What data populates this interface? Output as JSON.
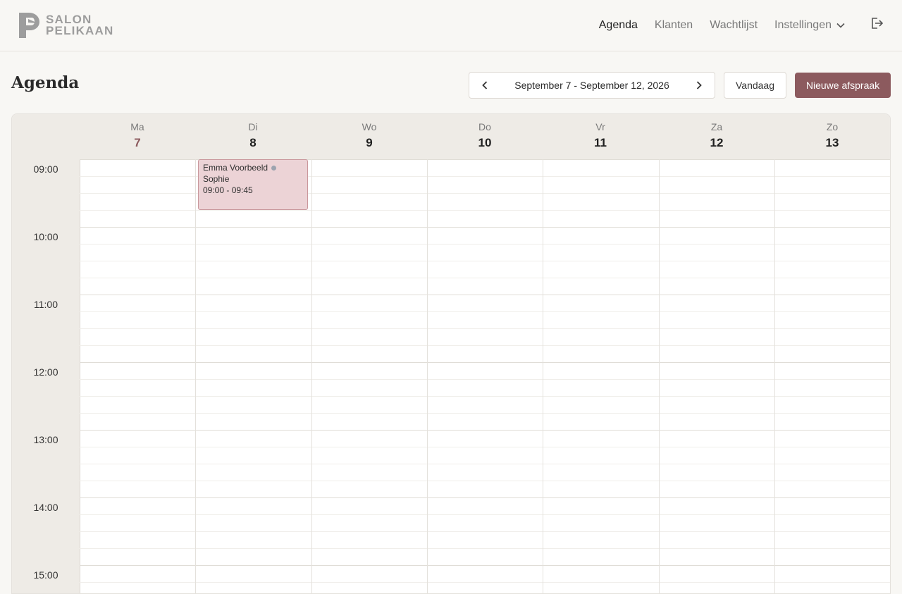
{
  "app": {
    "logo_line1": "SALON",
    "logo_line2": "PELIKAAN",
    "nav": [
      {
        "label": "Agenda",
        "active": true
      },
      {
        "label": "Klanten"
      },
      {
        "label": "Wachtlijst"
      },
      {
        "label": "Instellingen"
      }
    ]
  },
  "page": {
    "title": "Agenda",
    "date_range": "September 7 - September 12, 2026",
    "today_label": "Vandaag",
    "new_label": "Nieuwe afspraak"
  },
  "calendar": {
    "days": [
      {
        "name": "Ma",
        "date": "7",
        "today": true
      },
      {
        "name": "Di",
        "date": "8"
      },
      {
        "name": "Wo",
        "date": "9"
      },
      {
        "name": "Do",
        "date": "10"
      },
      {
        "name": "Vr",
        "date": "11"
      },
      {
        "name": "Za",
        "date": "12"
      },
      {
        "name": "Zo",
        "date": "13"
      }
    ],
    "hours": [
      "09:00",
      "10:00",
      "11:00",
      "12:00",
      "13:00",
      "14:00",
      "15:00"
    ],
    "appointments": [
      {
        "client": "Emma Voorbeeld",
        "staff": "Sophie",
        "time": "09:00 - 09:45",
        "day_index": 1,
        "status_color": "#9ca3af"
      }
    ]
  },
  "colors": {
    "accent": "#8c5a5e",
    "appointment_bg": "#ecd3d6"
  }
}
